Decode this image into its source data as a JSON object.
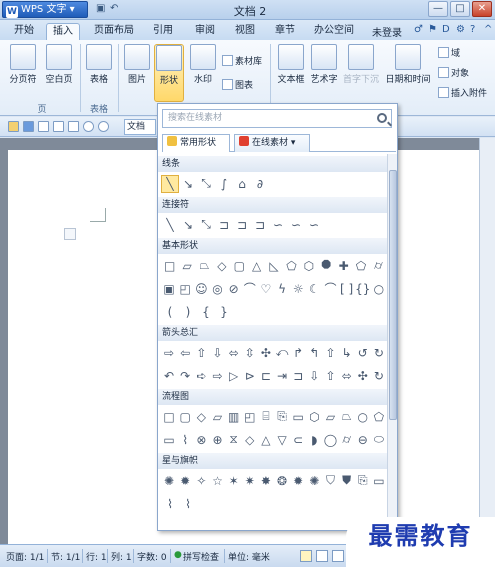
{
  "title": {
    "app_button": "WPS 文字",
    "doc_name": "文档 2",
    "controls": [
      "—",
      "□",
      "✕"
    ]
  },
  "tabs": [
    "开始",
    "插入",
    "页面布局",
    "引用",
    "审阅",
    "视图",
    "章节",
    "办公空间"
  ],
  "tabs_right": {
    "login": "未登录"
  },
  "ribbon": {
    "buttons": [
      "分页符",
      "空白页",
      "表格",
      "图片",
      "形状",
      "水印",
      "文本框",
      "艺术字",
      "首字下沉",
      "日期和时间"
    ],
    "small": {
      "material": "素材库",
      "chart": "图表",
      "field": "域",
      "object": "对象",
      "attachment": "插入附件"
    },
    "groups": [
      "页",
      "表格"
    ]
  },
  "doc_tab": "文档",
  "dropdown": {
    "search_placeholder": "搜索在线素材",
    "tabs": [
      "常用形状",
      "在线素材"
    ],
    "categories": [
      {
        "name": "线条"
      },
      {
        "name": "连接符"
      },
      {
        "name": "基本形状"
      },
      {
        "name": "箭头总汇"
      },
      {
        "name": "流程图"
      },
      {
        "name": "星与旗帜"
      }
    ]
  },
  "status": {
    "page": "页面: 1/1",
    "section": "节: 1/1",
    "row": "行: 1",
    "col": "列: 1",
    "words": "字数: 0",
    "spell": "拼写检查",
    "unit": "单位: 毫米"
  },
  "watermark": "最需教育"
}
